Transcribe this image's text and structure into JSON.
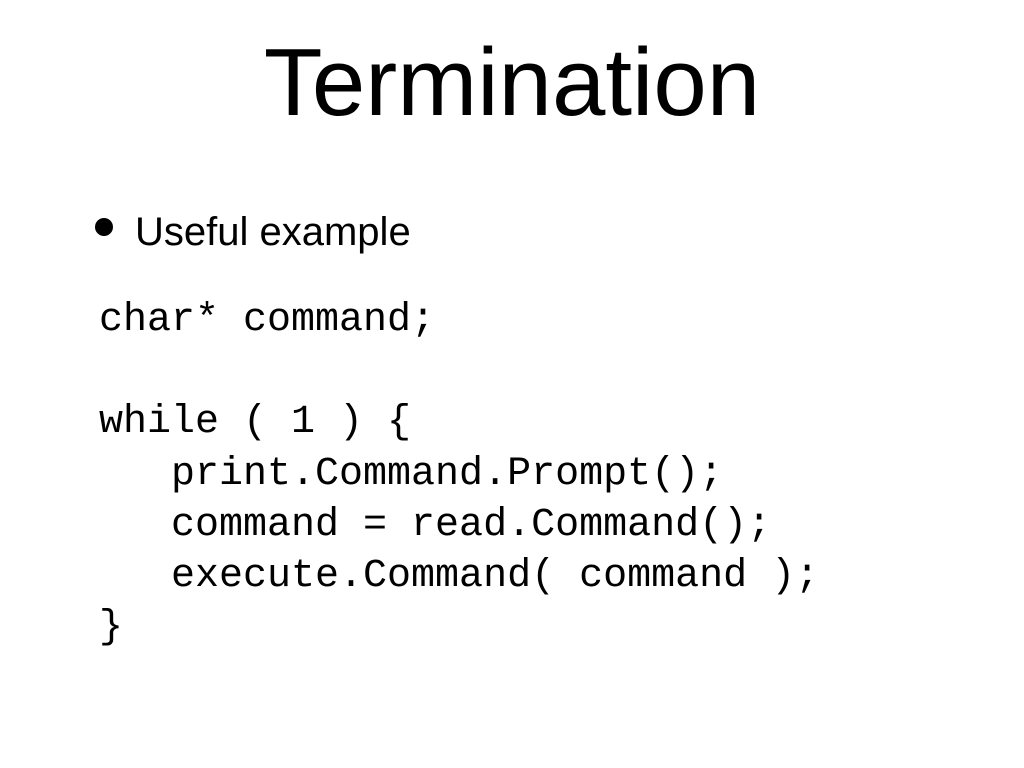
{
  "slide": {
    "title": "Termination",
    "bullet": "Useful example",
    "code": "char* command;\n\nwhile ( 1 ) {\n   print.Command.Prompt();\n   command = read.Command();\n   execute.Command( command );\n}"
  }
}
